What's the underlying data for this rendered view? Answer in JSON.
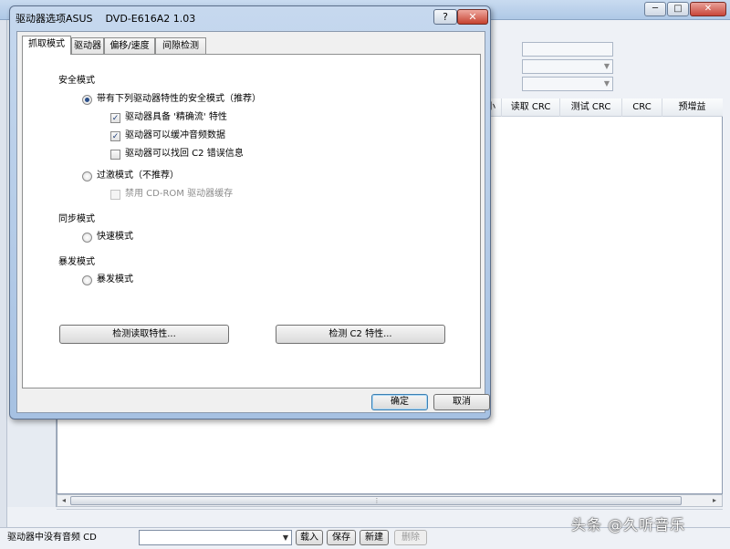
{
  "background_window": {
    "controls": {
      "minimize": "─",
      "maximize": "□",
      "close": "✕"
    },
    "list_headers": [
      "小",
      "读取 CRC",
      "测试 CRC",
      "CRC",
      "预增益"
    ],
    "status_text": "驱动器中没有音频 CD",
    "drive_select_value": "",
    "buttons": {
      "load": "载入",
      "save": "保存",
      "new": "新建",
      "delete": "删除"
    },
    "watermark": "头条 @久听音乐"
  },
  "dialog": {
    "title": "驱动器选项ASUS    DVD-E616A2 1.03",
    "help_label": "?",
    "close_label": "✕",
    "tabs": [
      {
        "label": "抓取模式",
        "active": true
      },
      {
        "label": "驱动器",
        "active": false
      },
      {
        "label": "偏移/速度",
        "active": false
      },
      {
        "label": "间隙检测",
        "active": false
      }
    ],
    "security_mode": {
      "heading": "安全模式",
      "option_secure": {
        "label": "带有下列驱动器特性的安全模式（推荐）",
        "selected": true
      },
      "features": [
        {
          "label": "驱动器具备 '精确流' 特性",
          "checked": true
        },
        {
          "label": "驱动器可以缓冲音频数据",
          "checked": true
        },
        {
          "label": "驱动器可以找回 C2 错误信息",
          "checked": false
        }
      ],
      "option_paranoid": {
        "label": "过激模式（不推荐）",
        "selected": false
      },
      "disable_cache": {
        "label": "禁用 CD-ROM 驱动器缓存",
        "checked": false
      }
    },
    "sync_mode": {
      "heading": "同步模式",
      "option": {
        "label": "快速模式",
        "selected": false
      }
    },
    "burst_mode": {
      "heading": "暴发模式",
      "option": {
        "label": "暴发模式",
        "selected": false
      }
    },
    "buttons": {
      "detect_read": "检测读取特性...",
      "detect_c2": "检测 C2 特性...",
      "ok": "确定",
      "cancel": "取消"
    }
  }
}
